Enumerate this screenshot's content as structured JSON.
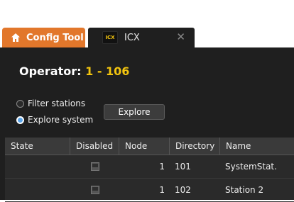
{
  "tabs": [
    {
      "label": "Config Tool",
      "icon": "home-icon",
      "color": "#e2772b"
    },
    {
      "label": "ICX",
      "badge": "ICX",
      "icon": "close-icon"
    }
  ],
  "main": {
    "operator_label": "Operator:",
    "operator_value": "1 - 106",
    "accent_color": "#f2c40f",
    "radios": [
      {
        "label": "Filter stations",
        "checked": false
      },
      {
        "label": "Explore system",
        "checked": true
      }
    ],
    "explore_button": "Explore"
  },
  "table": {
    "columns": [
      "State",
      "Disabled",
      "Node",
      "Directory",
      "Name"
    ],
    "rows": [
      {
        "state": "",
        "disabled": false,
        "node": "1",
        "directory": "101",
        "name": "SystemStat."
      },
      {
        "state": "",
        "disabled": false,
        "node": "1",
        "directory": "102",
        "name": "Station 2"
      }
    ]
  }
}
